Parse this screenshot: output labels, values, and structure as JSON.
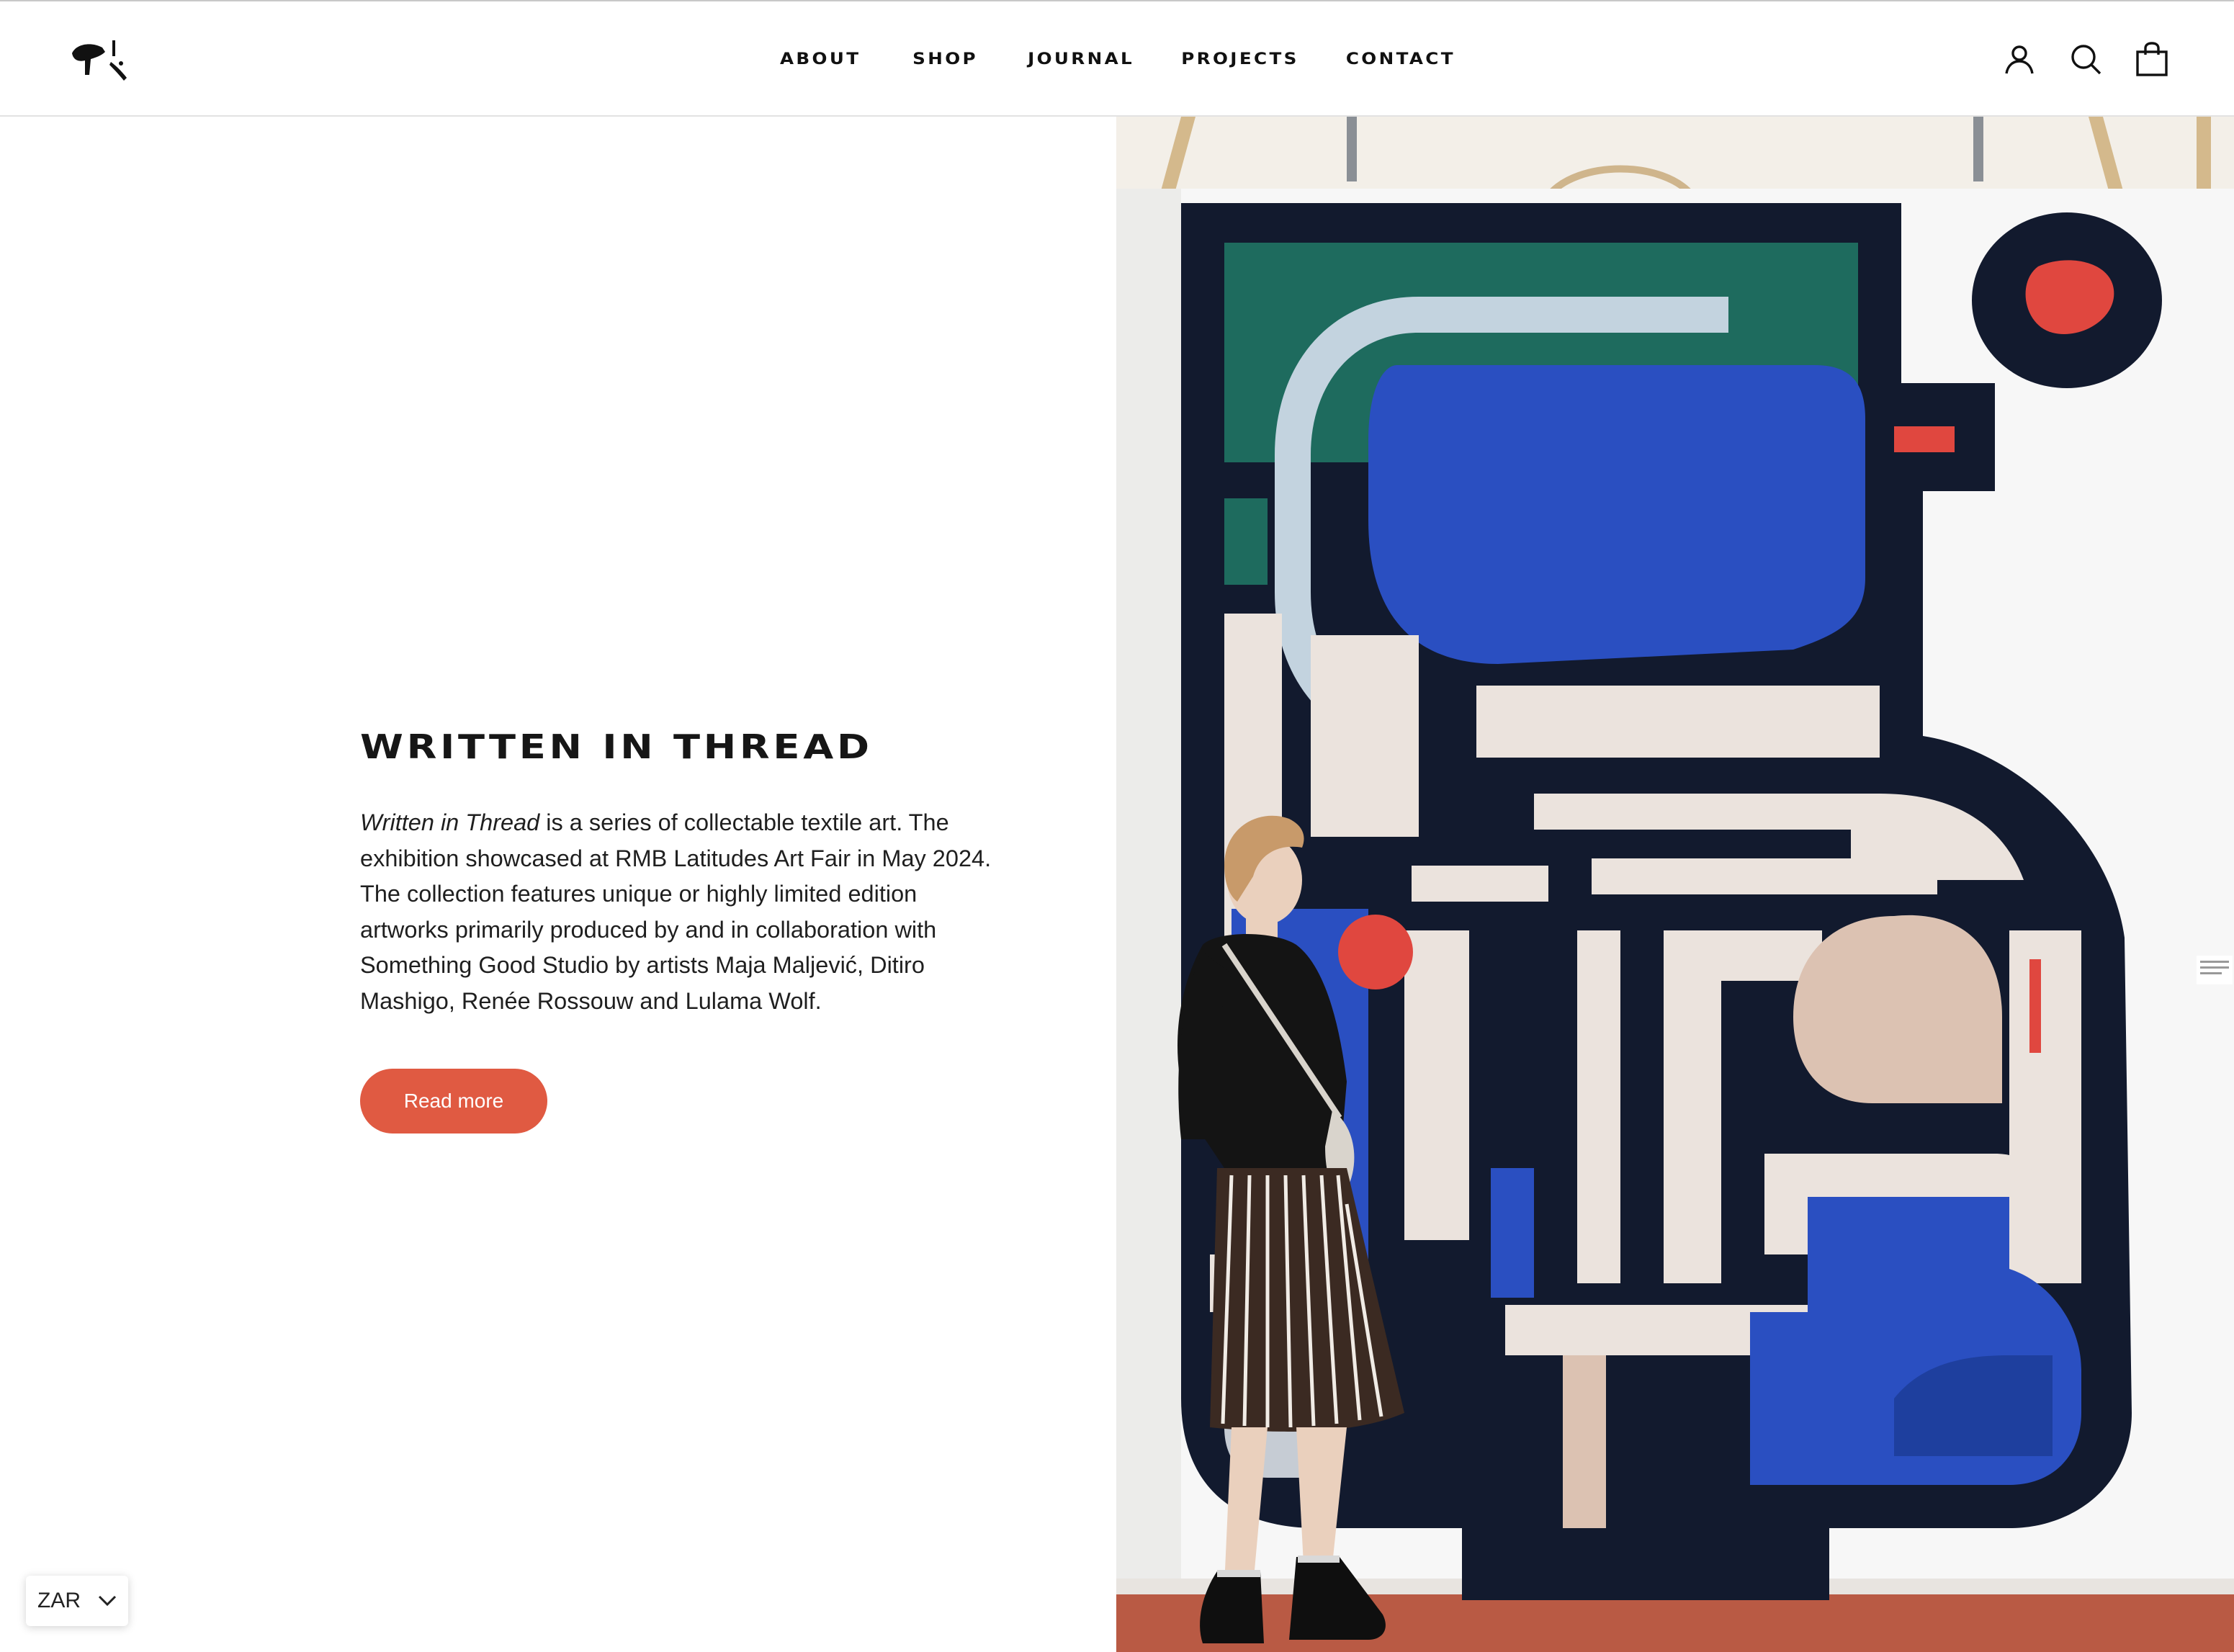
{
  "header": {
    "logo_name": "studio-logo",
    "nav": [
      {
        "label": "ABOUT"
      },
      {
        "label": "SHOP"
      },
      {
        "label": "JOURNAL"
      },
      {
        "label": "PROJECTS"
      },
      {
        "label": "CONTACT"
      }
    ],
    "icons": [
      "account-icon",
      "search-icon",
      "cart-bag-icon"
    ]
  },
  "feature": {
    "title": "WRITTEN IN THREAD",
    "description_italic": "Written in Thread",
    "description_rest": " is a series of collectable textile art. The exhibition showcased at RMB Latitudes Art Fair in May 2024. The collection features unique or highly limited edition artworks primarily produced by and in collaboration with Something Good Studio by artists Maja Maljević, Ditiro Mashigo, Renée Rossouw and Lulama Wolf.",
    "button_label": "Read more"
  },
  "currency": {
    "selected": "ZAR"
  },
  "colors": {
    "accent": "#e05a42",
    "rug_navy": "#121a2e",
    "rug_blue": "#2a4fc1",
    "rug_green": "#1e6b5e",
    "rug_cream": "#ebe3dd",
    "rug_tan": "#dcc2b2",
    "rug_red": "#e0473f"
  }
}
